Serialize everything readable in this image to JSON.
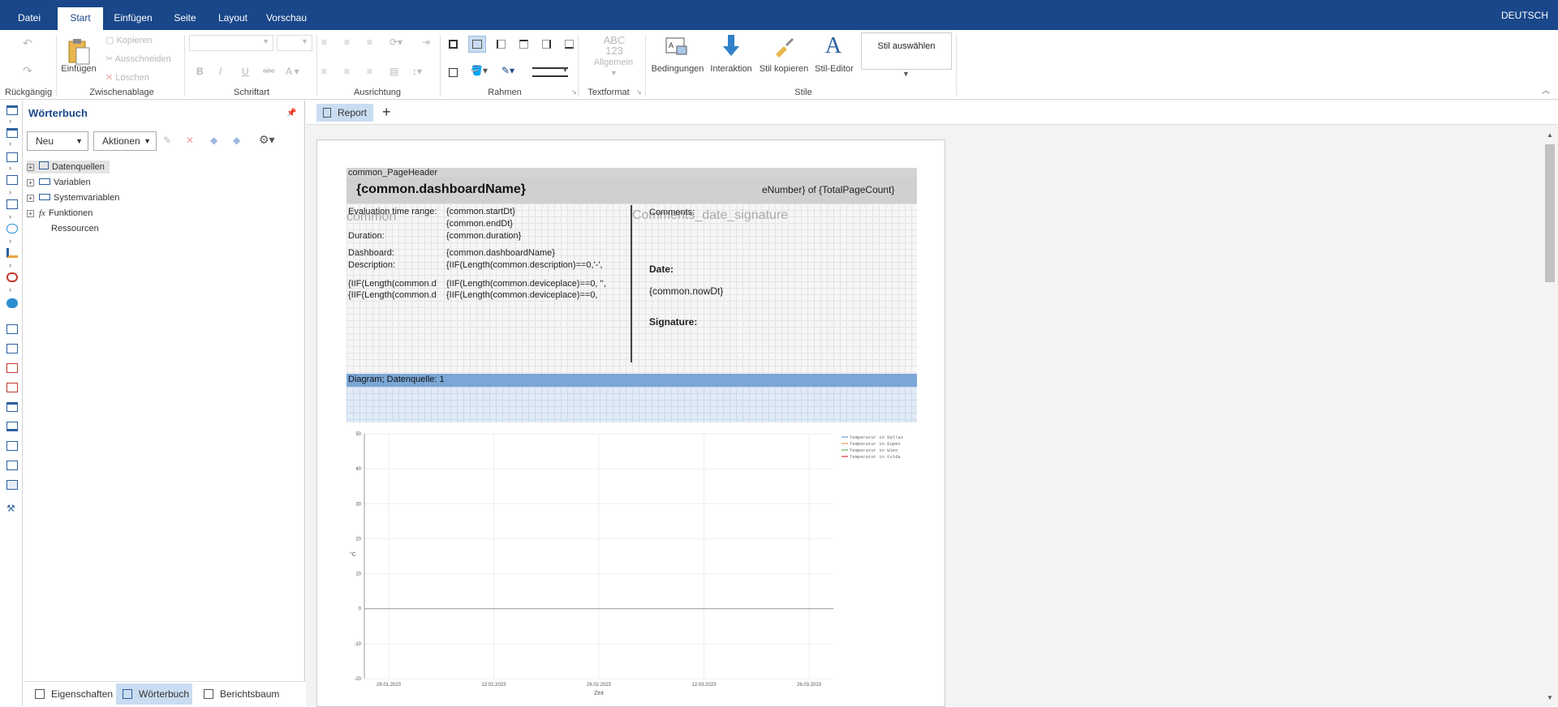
{
  "menu": {
    "tabs": [
      "Datei",
      "Start",
      "Einfügen",
      "Seite",
      "Layout",
      "Vorschau"
    ],
    "active": "Start",
    "language": "DEUTSCH"
  },
  "ribbon": {
    "undo_group": "Rückgängig",
    "clipboard": {
      "paste": "Einfügen",
      "copy": "Kopieren",
      "cut": "Ausschneiden",
      "delete": "Löschen",
      "label": "Zwischenablage"
    },
    "font_label": "Schriftart",
    "align_label": "Ausrichtung",
    "border_label": "Rahmen",
    "textformat": {
      "sample": "ABC\n123",
      "label": "Allgemein",
      "group": "Textformat"
    },
    "styles": {
      "conditions": "Bedingungen",
      "interaction": "Interaktion",
      "copy_style": "Stil kopieren",
      "style_editor": "Stil-Editor",
      "select_style": "Stil auswählen",
      "label": "Stile"
    }
  },
  "dictionary": {
    "title": "Wörterbuch",
    "new_button": "Neu",
    "actions_button": "Aktionen",
    "tree": [
      "Datenquellen",
      "Variablen",
      "Systemvariablen",
      "Funktionen",
      "Ressourcen"
    ]
  },
  "bottom_tabs": [
    "Eigenschaften",
    "Wörterbuch",
    "Berichtsbaum"
  ],
  "page_tab": "Report",
  "report": {
    "page_header_band": "common_PageHeader",
    "dashboard_name": "{common.dashboardName}",
    "page_number": "eNumber} of {TotalPageCount}",
    "common_bg": "common",
    "signature_bg": "Comments_date_signature",
    "fields_left": [
      [
        "Evaluation time range:",
        "{common.startDt}"
      ],
      [
        "",
        "{common.endDt}"
      ],
      [
        "Duration:",
        "{common.duration}"
      ],
      [
        "Dashboard:",
        "{common.dashboardName}"
      ],
      [
        "Description:",
        "{IIF(Length(common.description)==0,'-',"
      ],
      [
        "{IIF(Length(common.d",
        "{IIF(Length(common.deviceplace)==0, '',"
      ],
      [
        "{IIF(Length(common.d",
        "{IIF(Length(common.deviceplace)==0,"
      ]
    ],
    "comments": "Comments:",
    "date": "Date:",
    "now_dt": "{common.nowDt}",
    "signature": "Signature:",
    "diagram_band": "Diagram; Datenquelle: 1"
  },
  "chart_data": {
    "type": "line",
    "ylim": [
      -20,
      50
    ],
    "yticks": [
      "50",
      "40",
      "30",
      "20",
      "10",
      "0",
      "-10",
      "-20"
    ],
    "xticks": [
      "29.01.2023",
      "12.02.2023",
      "26.02.2023",
      "12.03.2023",
      "26.03.2023"
    ],
    "xlabel": "Zeit",
    "ylabel": "°C",
    "series": [
      {
        "name": "Temperatur in Dallas",
        "color": "#8cb4d8"
      },
      {
        "name": "Temperatur in Eupen",
        "color": "#f0b080"
      },
      {
        "name": "Temperatur in Wien",
        "color": "#7fc77f"
      },
      {
        "name": "Temperatur in Fulda",
        "color": "#e06060"
      }
    ]
  }
}
